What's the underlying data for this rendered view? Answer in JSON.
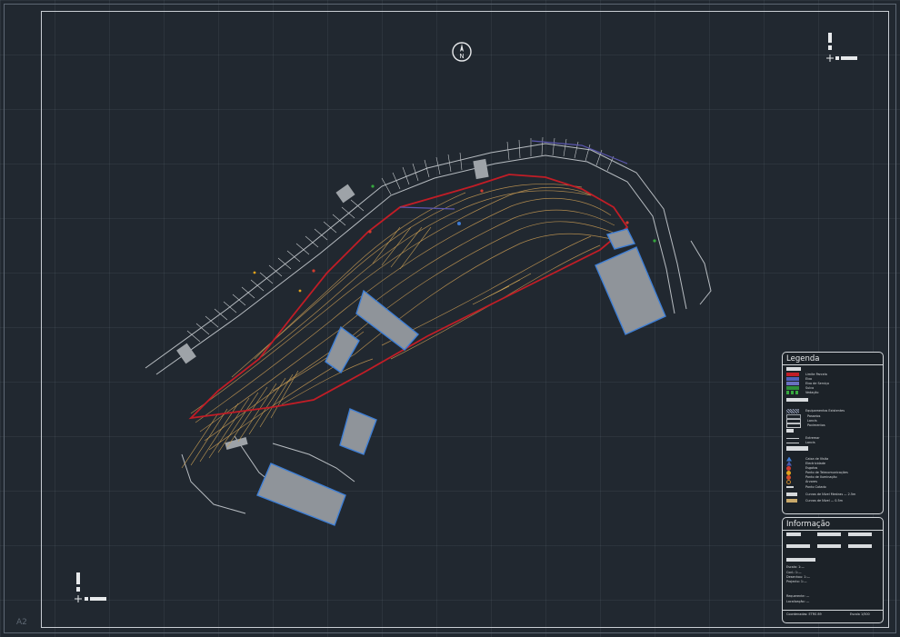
{
  "sheet": {
    "size_label": "A2"
  },
  "north_arrow": {
    "label": "N"
  },
  "legend": {
    "title": "Legenda",
    "groups": [
      {
        "items": [
          {
            "label": "Limite Parcela",
            "color": "#c21d26"
          },
          {
            "label": "Eixo",
            "color": "#4f5fb8"
          },
          {
            "label": "Eixo de Serviço",
            "color": "#6a71c0"
          },
          {
            "label": "Sulco",
            "color": "#2e8f3a"
          },
          {
            "label": "Vedação",
            "color": "#36a83e"
          }
        ]
      },
      {
        "items": [
          {
            "label": "Equipamentos Existentes",
            "color": "#8f98b0"
          },
          {
            "label": "Passeios",
            "color": "#9aa0a6"
          },
          {
            "label": "Lancis",
            "color": "#b5b9bd"
          },
          {
            "label": "Pavimentos",
            "color": "#c4c7ca"
          }
        ]
      },
      {
        "items": [
          {
            "label": "Extremar",
            "color": "#c8cbce"
          },
          {
            "label": "Lancis",
            "color": "#c8cbce"
          }
        ]
      },
      {
        "items": [
          {
            "label": "Caixa de Visita",
            "color": "#3e7bd1"
          },
          {
            "label": "Electricidade",
            "color": "#4c5ab0"
          },
          {
            "label": "Esgotos",
            "color": "#d13b2f"
          },
          {
            "label": "Ponto de Telecomunicações",
            "color": "#e3a21a"
          },
          {
            "label": "Ponto de Iluminação",
            "color": "#d24b2a"
          },
          {
            "label": "Árvores",
            "color": "#c7852b"
          },
          {
            "label": "Ponto Cotado",
            "color": "#cfd3d6"
          },
          {
            "label": "Curvas de Nível Mestras — 2.5m",
            "color": "#d6d9dc"
          },
          {
            "label": "Curvas de Nível — 0.5m",
            "color": "#c9a96a"
          }
        ]
      }
    ]
  },
  "info": {
    "title": "Informação",
    "fields": [
      {
        "label": "Escala: 1:—"
      },
      {
        "label": "Cod.: 1:—"
      },
      {
        "label": "Desenhou: 1:—"
      },
      {
        "label": "Projecto: 1:—"
      },
      {
        "label": "Requerente: —"
      },
      {
        "label": "Localização: —"
      }
    ],
    "footer_left": "Coordenadas: ETRS 89",
    "footer_right": "Escala 1/500"
  },
  "colors": {
    "background": "#212830",
    "parcel_boundary": "#c21d26",
    "contours": "#b08a4e",
    "roads": "#b7bcc1",
    "buildings": "#3e7fd6",
    "kerb": "#5b57b0"
  }
}
